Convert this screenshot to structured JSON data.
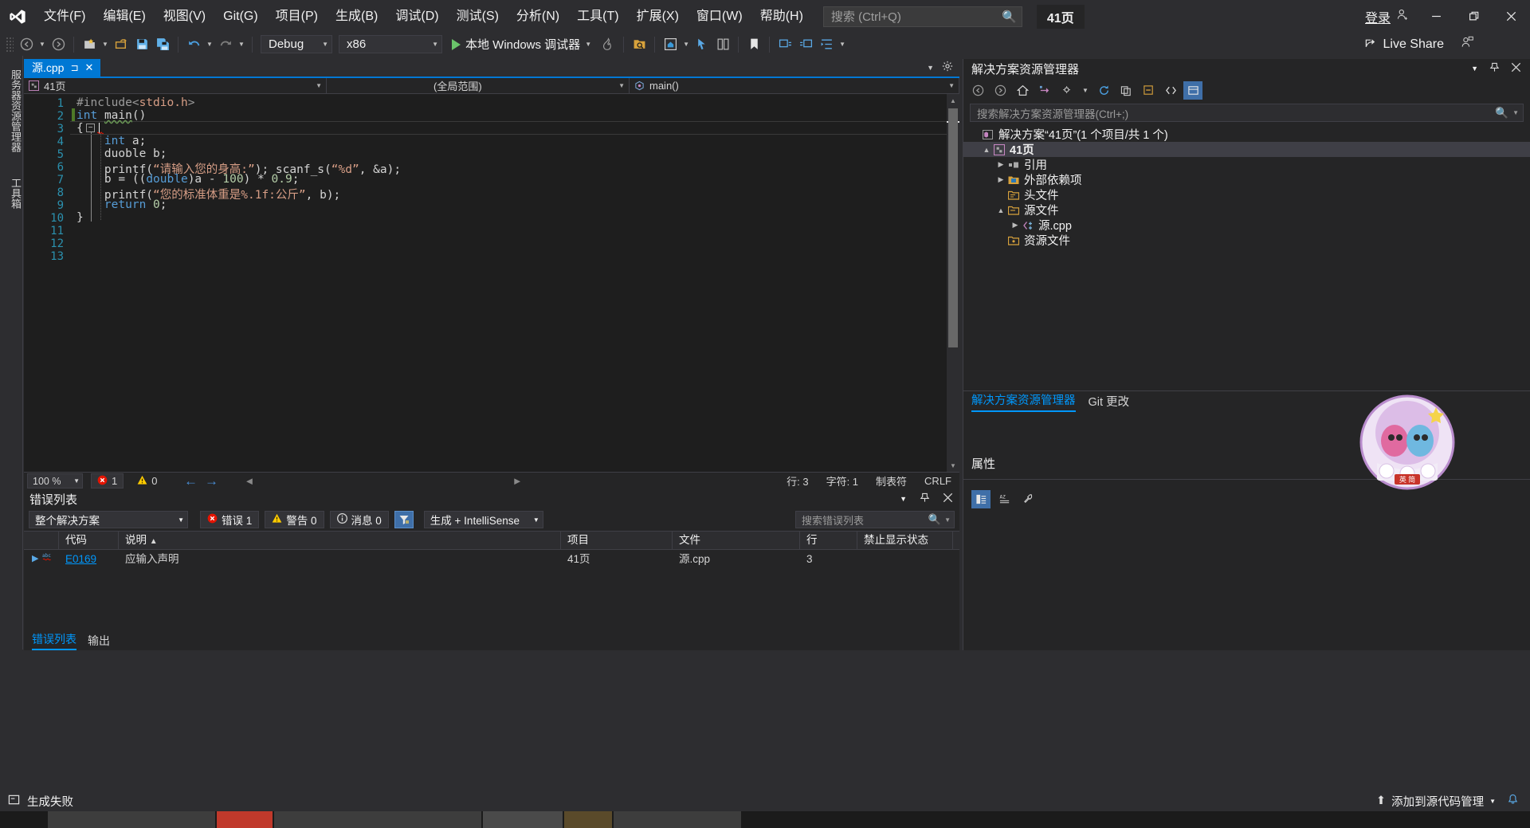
{
  "titlebar": {
    "logo": "vs-logo",
    "menus": [
      {
        "label": "文件(F)",
        "key": "F"
      },
      {
        "label": "编辑(E)",
        "key": "E"
      },
      {
        "label": "视图(V)",
        "key": "V"
      },
      {
        "label": "Git(G)",
        "key": "G"
      },
      {
        "label": "项目(P)",
        "key": "P"
      },
      {
        "label": "生成(B)",
        "key": "B"
      },
      {
        "label": "调试(D)",
        "key": "D"
      },
      {
        "label": "测试(S)",
        "key": "S"
      },
      {
        "label": "分析(N)",
        "key": "N"
      },
      {
        "label": "工具(T)",
        "key": "T"
      },
      {
        "label": "扩展(X)",
        "key": "X"
      },
      {
        "label": "窗口(W)",
        "key": "W"
      },
      {
        "label": "帮助(H)",
        "key": "H"
      }
    ],
    "search_placeholder": "搜索 (Ctrl+Q)",
    "project_badge": "41页",
    "signin_label": "登录",
    "minimize": "–",
    "maximize": "❐",
    "close": "✕"
  },
  "toolbar": {
    "config": "Debug",
    "platform": "x86",
    "run_label": "本地 Windows 调试器",
    "liveshare_label": "Live Share"
  },
  "vtabs": [
    {
      "label": "服务器资源管理器"
    },
    {
      "label": "工具箱"
    }
  ],
  "editor": {
    "tab_label": "源.cpp",
    "nav_scope_left": "41页",
    "nav_scope_mid": "(全局范围)",
    "nav_scope_right": "main()",
    "lines": [
      {
        "n": "1",
        "text": "#include<stdio.h>"
      },
      {
        "n": "2",
        "text": "int main()"
      },
      {
        "n": "3",
        "text": "{"
      },
      {
        "n": "4",
        "text": "    int a;"
      },
      {
        "n": "5",
        "text": "    duoble b;"
      },
      {
        "n": "6",
        "text": "    printf(“请输入您的身高:”); scanf_s(“%d”, &a);"
      },
      {
        "n": "7",
        "text": "    b = ((double)a - 100) * 0.9;"
      },
      {
        "n": "8",
        "text": "    printf(“您的标准体重是%.1f:公斤”, b);"
      },
      {
        "n": "9",
        "text": "    return 0;"
      },
      {
        "n": "10",
        "text": "}"
      },
      {
        "n": "11",
        "text": ""
      },
      {
        "n": "12",
        "text": ""
      },
      {
        "n": "13",
        "text": ""
      }
    ],
    "status": {
      "zoom": "100 %",
      "error_count": "1",
      "warning_count": "0",
      "row": "行: 3",
      "col": "字符: 1",
      "tab_mode": "制表符",
      "eol": "CRLF"
    }
  },
  "error_panel": {
    "title": "错误列表",
    "scope_filter": "整个解决方案",
    "errors_btn": "错误 1",
    "warnings_btn": "警告 0",
    "messages_btn": "消息 0",
    "build_filter": "生成 + IntelliSense",
    "search_placeholder": "搜索错误列表",
    "columns": [
      "",
      "代码",
      "说明",
      "项目",
      "文件",
      "行",
      "禁止显示状态"
    ],
    "rows": [
      {
        "icon": "abc-icon",
        "code": "E0169",
        "description": "应输入声明",
        "project": "41页",
        "file": "源.cpp",
        "line": "3",
        "suppression": ""
      }
    ],
    "tabs": [
      {
        "label": "错误列表",
        "active": true
      },
      {
        "label": "输出",
        "active": false
      }
    ]
  },
  "solution_explorer": {
    "title": "解决方案资源管理器",
    "search_placeholder": "搜索解决方案资源管理器(Ctrl+;)",
    "tree": [
      {
        "label": "解决方案“41页”(1 个项目/共 1 个)",
        "depth": 0,
        "twisty": "",
        "icon": "solution-icon"
      },
      {
        "label": "41页",
        "depth": 1,
        "twisty": "▲",
        "icon": "project-icon",
        "selected": true
      },
      {
        "label": "引用",
        "depth": 2,
        "twisty": "▶",
        "icon": "references-icon"
      },
      {
        "label": "外部依赖项",
        "depth": 2,
        "twisty": "▶",
        "icon": "external-deps-icon"
      },
      {
        "label": "头文件",
        "depth": 2,
        "twisty": "",
        "icon": "header-folder-icon"
      },
      {
        "label": "源文件",
        "depth": 2,
        "twisty": "▲",
        "icon": "source-folder-icon"
      },
      {
        "label": "源.cpp",
        "depth": 3,
        "twisty": "▶",
        "icon": "cpp-file-icon"
      },
      {
        "label": "资源文件",
        "depth": 2,
        "twisty": "",
        "icon": "resource-folder-icon"
      }
    ],
    "tabs": [
      {
        "label": "解决方案资源管理器",
        "active": true
      },
      {
        "label": "Git 更改",
        "active": false
      }
    ],
    "properties_title": "属性"
  },
  "statusbar": {
    "build_status": "生成失败",
    "source_control": "添加到源代码管理",
    "bell": "🔔"
  },
  "colors": {
    "accent": "#0078d4",
    "chrome": "#2d2d30",
    "panel": "#252526",
    "editor_bg": "#1e1e1e",
    "keyword": "#569cd6",
    "string": "#d69d85",
    "number": "#b5cea8",
    "linenum": "#2b91af",
    "error_red": "#e51400",
    "warning_yellow": "#ffcc00",
    "link": "#0097fb"
  }
}
